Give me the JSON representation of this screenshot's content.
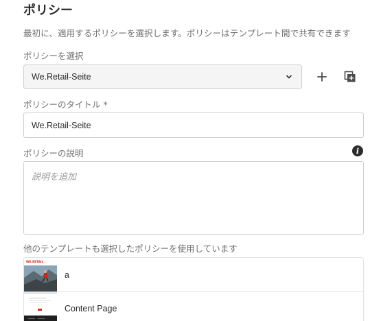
{
  "policy": {
    "heading": "ポリシー",
    "description": "最初に、適用するポリシーを選択します。ポリシーはテンプレート間で共有できます",
    "select_label": "ポリシーを選択",
    "select_value": "We.Retail-Seite",
    "title_label": "ポリシーのタイトル *",
    "title_value": "We.Retail-Seite",
    "desc_label": "ポリシーの説明",
    "desc_placeholder": "説明を追加",
    "shared_label": "他のテンプレートも選択したポリシーを使用しています"
  },
  "templates": [
    {
      "name": "a",
      "thumb_logo": "WE.RETAIL",
      "icon": "climber-thumbnail"
    },
    {
      "name": "Content Page",
      "icon": "content-page-thumbnail"
    }
  ],
  "colors": {
    "accent": "#e1251b",
    "text": "#2c2c2c",
    "muted": "#6e6e6e",
    "border": "#cfcfcf"
  }
}
